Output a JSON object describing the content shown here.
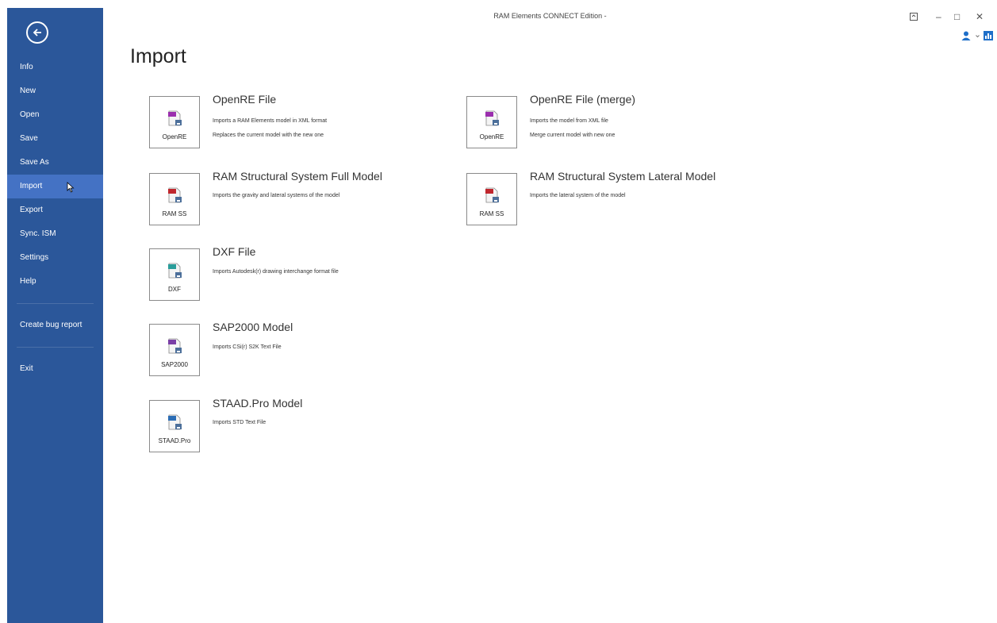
{
  "window": {
    "title": "RAM Elements CONNECT Edition -",
    "controls": [
      "restore-ribbon-icon",
      "minimize-icon",
      "maximize-icon",
      "close-icon"
    ],
    "minimize_glyph": "–",
    "maximize_glyph": "□",
    "close_glyph": "✕"
  },
  "colors": {
    "sidebar": "#2b579a",
    "sidebar_active": "#4472c4",
    "accent_user": "#1e6fc9"
  },
  "sidebar": {
    "items": [
      {
        "label": "Info"
      },
      {
        "label": "New"
      },
      {
        "label": "Open"
      },
      {
        "label": "Save"
      },
      {
        "label": "Save As"
      },
      {
        "label": "Import",
        "active": true
      },
      {
        "label": "Export"
      },
      {
        "label": "Sync. ISM"
      },
      {
        "label": "Settings"
      },
      {
        "label": "Help"
      },
      {
        "label": "Create bug report"
      },
      {
        "label": "Exit"
      }
    ]
  },
  "page": {
    "title": "Import"
  },
  "options": [
    {
      "button_label": "OpenRE",
      "icon_tag": "XML",
      "title": "OpenRE File",
      "description": [
        "Imports a RAM Elements model in XML format",
        "Replaces the current model with the new one"
      ]
    },
    {
      "button_label": "OpenRE",
      "icon_tag": "XML",
      "title": "OpenRE File (merge)",
      "description": [
        "Imports the model from XML file",
        "Merge current model with new one"
      ]
    },
    {
      "button_label": "RAM SS",
      "icon_tag": "RSS",
      "title": "RAM Structural System Full Model",
      "description": [
        "Imports the gravity and lateral systems of the model"
      ]
    },
    {
      "button_label": "RAM SS",
      "icon_tag": "RSS",
      "title": "RAM Structural System Lateral Model",
      "description": [
        "Imports the lateral system of the model"
      ]
    },
    {
      "button_label": "DXF",
      "icon_tag": "DXF",
      "title": "DXF File",
      "description": [
        "Imports Autodesk(r) drawing interchange format file"
      ]
    },
    {
      "button_label": "SAP2000",
      "icon_tag": "S2K",
      "title": "SAP2000 Model",
      "description": [
        "Imports CSi(r) S2K Text File"
      ]
    },
    {
      "button_label": "STAAD.Pro",
      "icon_tag": "STD",
      "title": "STAAD.Pro Model",
      "description": [
        "Imports STD Text File"
      ]
    }
  ]
}
